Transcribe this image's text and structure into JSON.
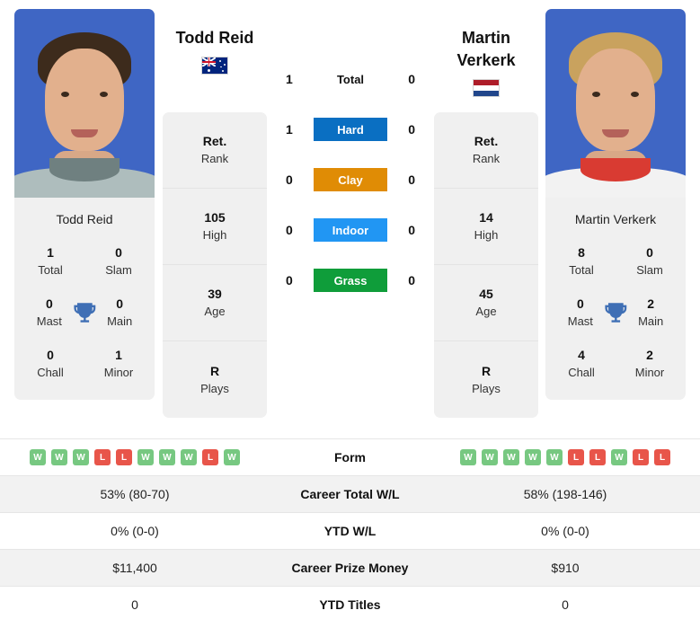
{
  "players": {
    "left": {
      "name": "Todd Reid",
      "caption": "Todd Reid",
      "flag": "australia-flag",
      "info": [
        {
          "value": "Ret.",
          "label": "Rank"
        },
        {
          "value": "105",
          "label": "High"
        },
        {
          "value": "39",
          "label": "Age"
        },
        {
          "value": "R",
          "label": "Plays"
        }
      ],
      "titles": {
        "total": "1",
        "slam": "0",
        "mast": "0",
        "main": "0",
        "chall": "0",
        "minor": "1"
      },
      "form": [
        "W",
        "W",
        "W",
        "L",
        "L",
        "W",
        "W",
        "W",
        "L",
        "W"
      ],
      "career_total_wl": "53% (80-70)",
      "ytd_wl": "0% (0-0)",
      "career_prize_money": "$11,400",
      "ytd_titles": "0"
    },
    "right": {
      "name": "Martin Verkerk",
      "name_line1": "Martin",
      "name_line2": "Verkerk",
      "caption": "Martin Verkerk",
      "flag": "netherlands-flag",
      "info": [
        {
          "value": "Ret.",
          "label": "Rank"
        },
        {
          "value": "14",
          "label": "High"
        },
        {
          "value": "45",
          "label": "Age"
        },
        {
          "value": "R",
          "label": "Plays"
        }
      ],
      "titles": {
        "total": "8",
        "slam": "0",
        "mast": "0",
        "main": "2",
        "chall": "4",
        "minor": "2"
      },
      "form": [
        "W",
        "W",
        "W",
        "W",
        "W",
        "L",
        "L",
        "W",
        "L",
        "L"
      ],
      "career_total_wl": "58% (198-146)",
      "ytd_wl": "0% (0-0)",
      "career_prize_money": "$910",
      "ytd_titles": "0"
    }
  },
  "labels": {
    "total": "Total",
    "slam": "Slam",
    "mast": "Mast",
    "main": "Main",
    "chall": "Chall",
    "minor": "Minor"
  },
  "surfaces": [
    {
      "name": "Total",
      "left": "1",
      "right": "0",
      "color": "transparent",
      "pill": false
    },
    {
      "name": "Hard",
      "left": "1",
      "right": "0",
      "color": "#0a6fc2",
      "pill": true
    },
    {
      "name": "Clay",
      "left": "0",
      "right": "0",
      "color": "#e08c05",
      "pill": true
    },
    {
      "name": "Indoor",
      "left": "0",
      "right": "0",
      "color": "#2196f3",
      "pill": true
    },
    {
      "name": "Grass",
      "left": "0",
      "right": "0",
      "color": "#0f9d3a",
      "pill": true
    }
  ],
  "table": {
    "form_label": "Form",
    "rows": [
      {
        "label": "Career Total W/L",
        "left": "53% (80-70)",
        "right": "58% (198-146)"
      },
      {
        "label": "YTD W/L",
        "left": "0% (0-0)",
        "right": "0% (0-0)"
      },
      {
        "label": "Career Prize Money",
        "left": "$11,400",
        "right": "$910"
      },
      {
        "label": "YTD Titles",
        "left": "0",
        "right": "0"
      }
    ]
  },
  "colors": {
    "win_badge": "#77c881",
    "loss_badge": "#e8554a",
    "trophy": "#3f6fb5",
    "card_bg": "#f0f0f0",
    "row_shade": "#f2f2f2"
  }
}
